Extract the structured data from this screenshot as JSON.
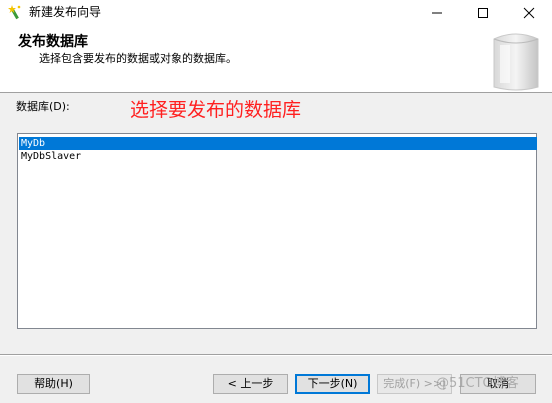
{
  "window": {
    "title": "新建发布向导",
    "icon": "wizard-wand-icon",
    "controls": [
      "minimize-icon",
      "maximize-icon",
      "close-icon"
    ]
  },
  "header": {
    "title": "发布数据库",
    "subtitle": "选择包含要发布的数据或对象的数据库。",
    "graphic": "database-cylinder-icon"
  },
  "main": {
    "list_label": "数据库(D):",
    "annotation": "选择要发布的数据库",
    "annotation_color": "#ff2020",
    "databases": [
      {
        "name": "MyDb",
        "selected": true
      },
      {
        "name": "MyDbSlaver",
        "selected": false
      }
    ]
  },
  "footer": {
    "help": "帮助(H)",
    "back": "< 上一步",
    "next": "下一步(N)",
    "finish": "完成(F) >>|",
    "cancel": "取消",
    "watermark": "@51CTO博客"
  },
  "colors": {
    "selection": "#0078d7",
    "panel_bg": "#f0f0f0",
    "header_bg": "#ffffff"
  }
}
